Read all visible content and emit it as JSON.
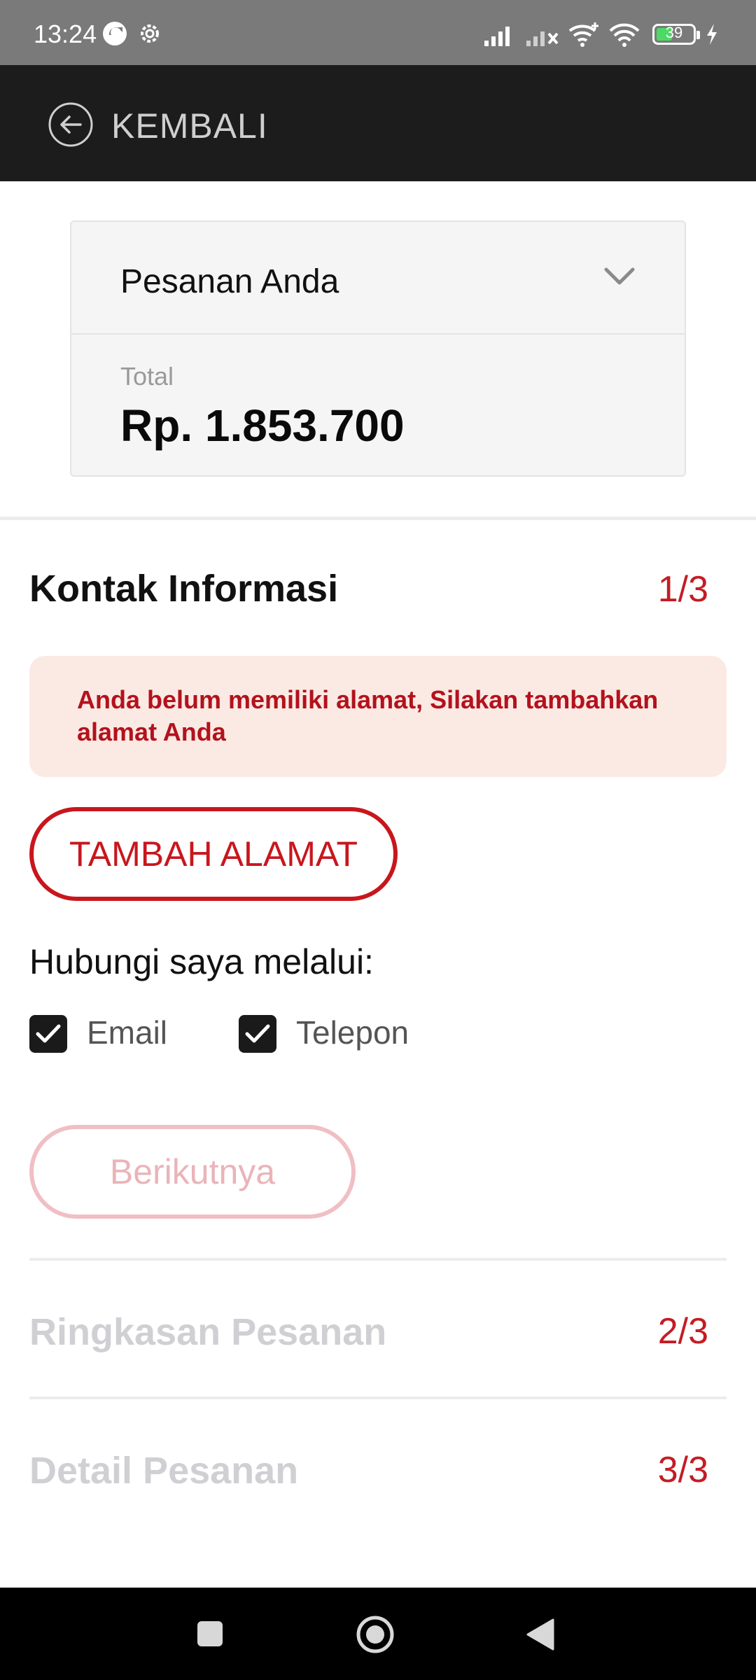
{
  "status_bar": {
    "time": "13:24",
    "battery_level": "39",
    "icons": [
      "sync-icon",
      "settings-icon",
      "signal-icon",
      "signal-no-service-icon",
      "wifi-plus-icon",
      "wifi-icon",
      "battery-icon",
      "charging-icon"
    ]
  },
  "app_bar": {
    "back_label": "KEMBALI"
  },
  "order_card": {
    "title": "Pesanan Anda",
    "total_label": "Total",
    "total_value": "Rp. 1.853.700"
  },
  "contact_section": {
    "title": "Kontak Informasi",
    "step": "1/3",
    "alert_message": "Anda belum memiliki alamat, Silakan tambahkan alamat Anda",
    "add_address_label": "TAMBAH ALAMAT",
    "contact_via_label": "Hubungi saya melalui:",
    "options": [
      {
        "label": "Email",
        "checked": true
      },
      {
        "label": "Telepon",
        "checked": true
      }
    ],
    "next_label": "Berikutnya"
  },
  "summary_section": {
    "title": "Ringkasan Pesanan",
    "step": "2/3"
  },
  "detail_section": {
    "title": "Detail Pesanan",
    "step": "3/3"
  },
  "colors": {
    "accent": "#c8161d",
    "appbar_bg": "#1c1c1c",
    "alert_bg": "#fbe9e4",
    "disabled_button": "#f0bfc3"
  }
}
